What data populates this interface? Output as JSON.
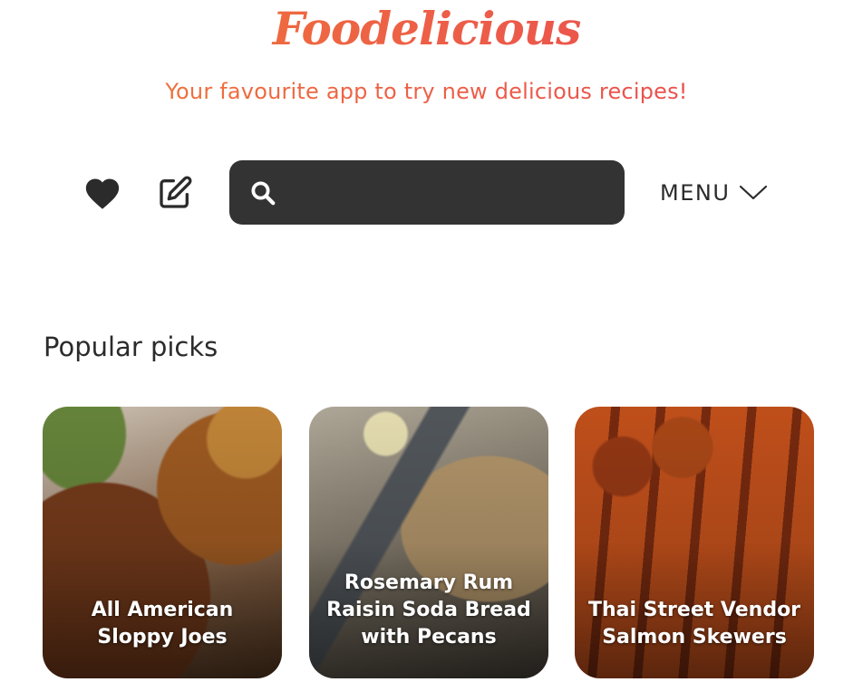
{
  "app": {
    "logo": "Foodelicious",
    "tagline": "Your favourite app to try new delicious recipes!"
  },
  "toolbar": {
    "favorites_icon": "heart-icon",
    "edit_icon": "edit-icon",
    "search": {
      "icon": "search-icon",
      "value": "",
      "placeholder": ""
    },
    "menu_label": "MENU",
    "menu_icon": "chevron-down-icon"
  },
  "popular": {
    "title": "Popular picks",
    "cards": [
      {
        "title": "All American Sloppy Joes"
      },
      {
        "title": "Rosemary Rum Raisin Soda Bread with Pecans"
      },
      {
        "title": "Thai Street Vendor Salmon Skewers"
      }
    ]
  },
  "colors": {
    "brand_orange": "#f07a34",
    "brand_red": "#e6474f",
    "search_bg": "#333333",
    "text_dark": "#2b2b2b"
  }
}
